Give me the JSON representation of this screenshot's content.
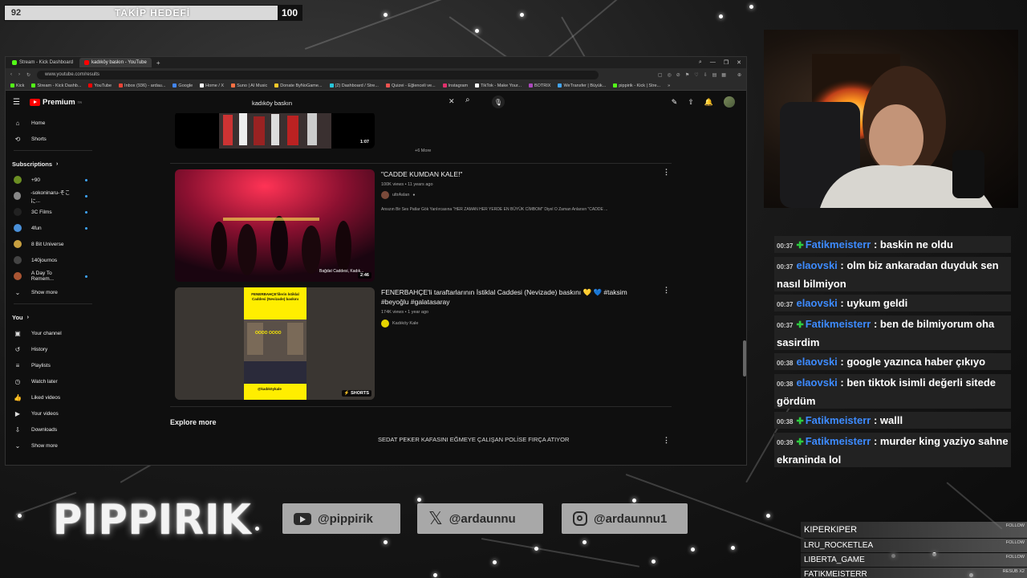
{
  "goal": {
    "current": "92",
    "label": "TAKİP HEDEFİ",
    "target": "100"
  },
  "browser": {
    "tabs": [
      {
        "label": "Stream - Kick Dashboard",
        "color": "#53fc18"
      },
      {
        "label": "kadıköy baskın - YouTube",
        "color": "#ff0000"
      }
    ],
    "new_tab": "+",
    "url": "www.youtube.com/results",
    "bookmarks": [
      {
        "label": "Kick",
        "color": "#53fc18"
      },
      {
        "label": "Stream - Kick Dashb...",
        "color": "#53fc18"
      },
      {
        "label": "YouTube",
        "color": "#ff0000"
      },
      {
        "label": "Inbox (936) - ardau...",
        "color": "#ea4335"
      },
      {
        "label": "Google",
        "color": "#4285f4"
      },
      {
        "label": "Home / X",
        "color": "#ffffff"
      },
      {
        "label": "Suno | AI Music",
        "color": "#ff7043"
      },
      {
        "label": "Donate ByNoGame...",
        "color": "#ffca28"
      },
      {
        "label": "(2) Dashboard / Stre...",
        "color": "#26c6da"
      },
      {
        "label": "Quizei - Eğlenceli ve...",
        "color": "#ef5350"
      },
      {
        "label": "Instagram",
        "color": "#e1306c"
      },
      {
        "label": "TikTok - Make Your...",
        "color": "#ffffff"
      },
      {
        "label": "BOTRIX",
        "color": "#ab47bc"
      },
      {
        "label": "WeTransfer | Büyük...",
        "color": "#42a5f5"
      },
      {
        "label": "pippirik - Kick | Stre...",
        "color": "#53fc18"
      }
    ]
  },
  "youtube": {
    "logo_text": "Premium",
    "logo_sup": "TR",
    "search_query": "kadıköy baskın",
    "sidebar": {
      "main": [
        {
          "icon": "home-icon",
          "glyph": "⌂",
          "label": "Home"
        },
        {
          "icon": "shorts-icon",
          "glyph": "⟲",
          "label": "Shorts"
        }
      ],
      "subs_header": "Subscriptions",
      "subs": [
        {
          "label": "+90",
          "color": "#6b8e23"
        },
        {
          "label": "-sokoninaru-そこに...",
          "color": "#888888"
        },
        {
          "label": "3C Films",
          "color": "#222222"
        },
        {
          "label": "4fun",
          "color": "#4a90d9"
        },
        {
          "label": "8 Bit Universe",
          "color": "#c8a040"
        },
        {
          "label": "140journos",
          "color": "#444444"
        },
        {
          "label": "A Day To Remem...",
          "color": "#aa5533"
        }
      ],
      "show_more": "Show more",
      "you_header": "You",
      "you": [
        {
          "icon": "your-channel-icon",
          "glyph": "▣",
          "label": "Your channel"
        },
        {
          "icon": "history-icon",
          "glyph": "↺",
          "label": "History"
        },
        {
          "icon": "playlists-icon",
          "glyph": "≡",
          "label": "Playlists"
        },
        {
          "icon": "watch-later-icon",
          "glyph": "◷",
          "label": "Watch later"
        },
        {
          "icon": "liked-videos-icon",
          "glyph": "👍",
          "label": "Liked videos"
        },
        {
          "icon": "your-videos-icon",
          "glyph": "▶",
          "label": "Your videos"
        },
        {
          "icon": "downloads-icon",
          "glyph": "⇩",
          "label": "Downloads"
        },
        {
          "icon": "show-more-icon",
          "glyph": "⌄",
          "label": "Show more"
        }
      ]
    },
    "results": {
      "prev_duration": "1:07",
      "more_link": "+6 More",
      "videos": [
        {
          "title": "\"CADDE KUMDAN KALE!\"",
          "meta": "100K views • 11 years ago",
          "channel": "ultrAslan",
          "desc": "Ansızın Bir Ses Patlar Gök Yarılırcasına \"HER ZAMAN HER YERDE EN BÜYÜK CİMBOM\" Diyel O Zaman Anlarsın \"CADDE ...",
          "duration": "2:46",
          "overlay": "Bağdat Caddesi, Kadık..."
        },
        {
          "title": "FENERBAHÇE'li taraftarlarının İstiklal Caddesi (Nevizade) baskını 💛 💙 #taksim #beyoğlu #galatasaray",
          "meta": "174K views • 1 year ago",
          "channel": "Kadıköy Kale",
          "badge": "SHORTS",
          "short_caption": "FENERBAHÇE'lilerin İstiklal Caddesi (Nevizade) baskını",
          "short_sub": "OOOO OOOO",
          "short_handle": "@kadıköykale"
        }
      ],
      "explore": "Explore more",
      "cutoff_title": "SEDAT PEKER KAFASINI EĞMEYE ÇALIŞAN POLİSE FIRÇA ATIYOR"
    }
  },
  "chat": [
    {
      "time": "00:37",
      "badge": true,
      "user": "Fatikmeisterr",
      "text": "baskin ne oldu"
    },
    {
      "time": "00:37",
      "badge": false,
      "user": "elaovski",
      "text": "olm biz ankaradan duyduk sen nasıl bilmiyon"
    },
    {
      "time": "00:37",
      "badge": false,
      "user": "elaovski",
      "text": "uykum geldi"
    },
    {
      "time": "00:37",
      "badge": true,
      "user": "Fatikmeisterr",
      "text": "ben de bilmiyorum oha sasirdim"
    },
    {
      "time": "00:38",
      "badge": false,
      "user": "elaovski",
      "text": "google yazınca haber çıkıyo"
    },
    {
      "time": "00:38",
      "badge": false,
      "user": "elaovski",
      "text": "ben tiktok isimli değerli sitede gördüm"
    },
    {
      "time": "00:38",
      "badge": true,
      "user": "Fatikmeisterr",
      "text": "walll"
    },
    {
      "time": "00:39",
      "badge": true,
      "user": "Fatikmeisterr",
      "text": "murder king yaziyo sahne ekraninda lol"
    }
  ],
  "socials": [
    {
      "icon": "youtube-icon",
      "handle": "@pippirik"
    },
    {
      "icon": "x-icon",
      "handle": "@ardaunnu"
    },
    {
      "icon": "instagram-icon",
      "handle": "@ardaunnu1"
    }
  ],
  "brand": "PIPPIRIK",
  "events": [
    {
      "name": "KIPERKIPER",
      "type": "FOLLOW"
    },
    {
      "name": "LRU_ROCKETLEA",
      "type": "FOLLOW"
    },
    {
      "name": "LIBERTA_GAME",
      "type": "FOLLOW"
    },
    {
      "name": "FATIKMEISTERR",
      "type": "RESUB X2"
    }
  ],
  "colors": {
    "accent_green": "#2ecc40",
    "chat_user": "#3d8bff",
    "yt_red": "#ff0000"
  }
}
